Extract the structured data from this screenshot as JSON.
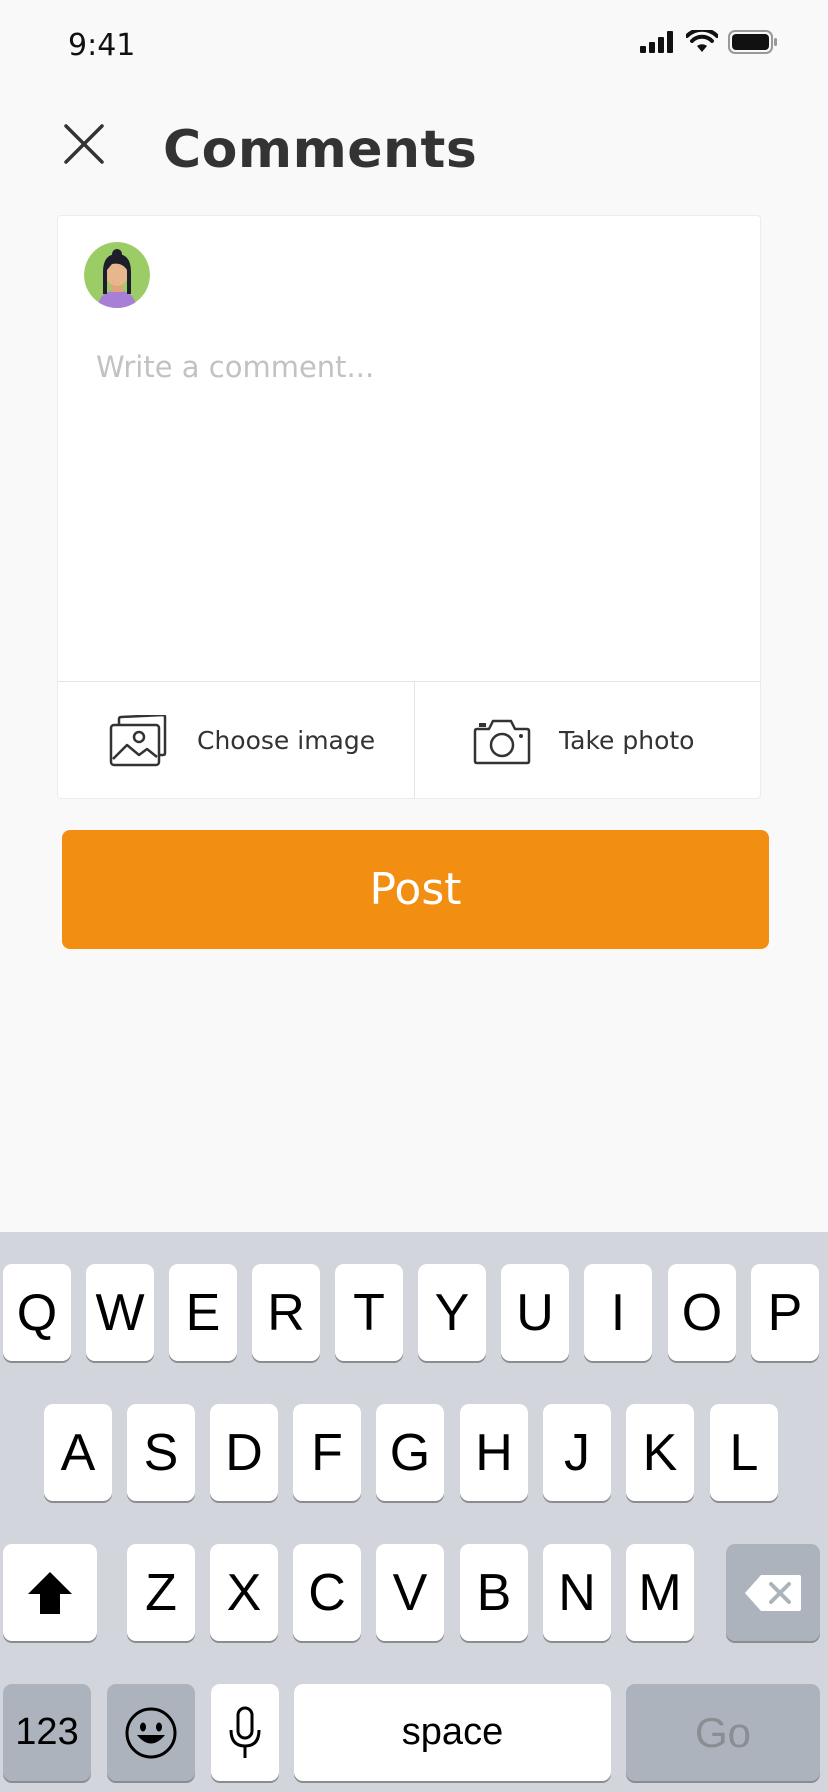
{
  "status_bar": {
    "time": "9:41"
  },
  "header": {
    "title": "Comments"
  },
  "composer": {
    "placeholder": "Write a comment...",
    "choose_image_label": "Choose image",
    "take_photo_label": "Take photo"
  },
  "post_button": {
    "label": "Post"
  },
  "keyboard": {
    "row1": [
      "Q",
      "W",
      "E",
      "R",
      "T",
      "Y",
      "U",
      "I",
      "O",
      "P"
    ],
    "row2": [
      "A",
      "S",
      "D",
      "F",
      "G",
      "H",
      "J",
      "K",
      "L"
    ],
    "row3": [
      "Z",
      "X",
      "C",
      "V",
      "B",
      "N",
      "M"
    ],
    "numbers_label": "123",
    "space_label": "space",
    "go_label": "Go"
  },
  "colors": {
    "accent": "#f28e12",
    "background": "#f9f9f9",
    "keyboard_bg": "#d2d5db"
  }
}
